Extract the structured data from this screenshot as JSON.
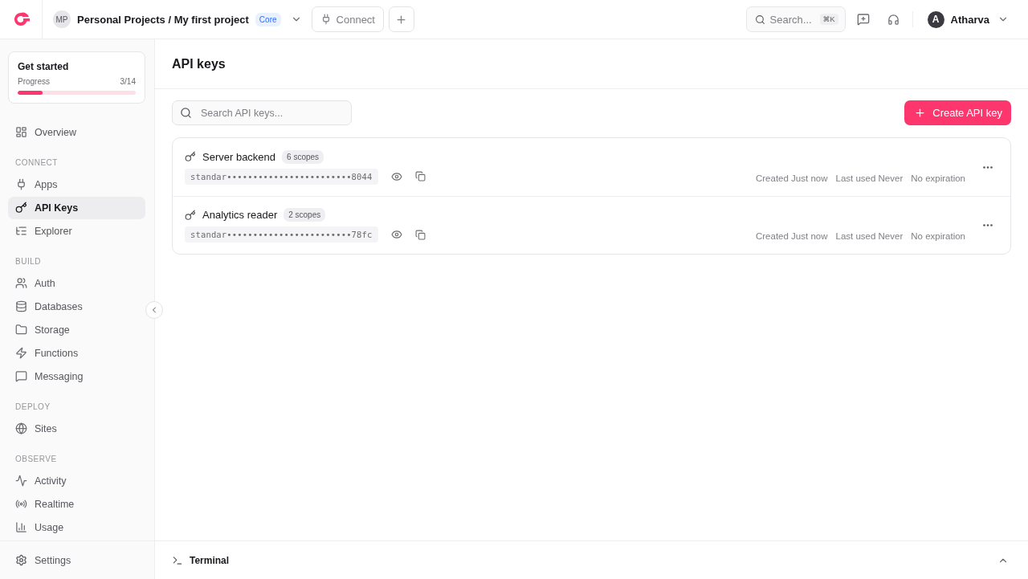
{
  "header": {
    "project_initials": "MP",
    "project_path": "Personal Projects / My first project",
    "plan_badge": "Core",
    "connect_button": "Connect",
    "search": {
      "placeholder": "Search...",
      "shortcut": "⌘K"
    },
    "user": {
      "initial": "A",
      "name": "Atharva"
    }
  },
  "sidebar": {
    "get_started": {
      "title": "Get started",
      "progress_label": "Progress",
      "progress_count": "3/14",
      "level": 0.21
    },
    "overview": {
      "label": "Overview",
      "selected": false
    },
    "sections": [
      {
        "heading": "CONNECT",
        "items": [
          {
            "label": "Apps",
            "selected": false
          },
          {
            "label": "API Keys",
            "selected": true
          },
          {
            "label": "Explorer",
            "selected": false
          }
        ]
      },
      {
        "heading": "BUILD",
        "items": [
          {
            "label": "Auth",
            "selected": false
          },
          {
            "label": "Databases",
            "selected": false
          },
          {
            "label": "Storage",
            "selected": false
          },
          {
            "label": "Functions",
            "selected": false
          },
          {
            "label": "Messaging",
            "selected": false
          }
        ]
      },
      {
        "heading": "DEPLOY",
        "items": [
          {
            "label": "Sites",
            "selected": false
          }
        ]
      },
      {
        "heading": "OBSERVE",
        "items": [
          {
            "label": "Activity",
            "selected": false
          },
          {
            "label": "Realtime",
            "selected": false
          },
          {
            "label": "Usage",
            "selected": false
          }
        ]
      }
    ],
    "settings": "Settings"
  },
  "page": {
    "title": "API keys",
    "search": {
      "placeholder": "Search API keys..."
    },
    "create_button": "Create API key",
    "keys": [
      {
        "name": "Server backend",
        "scopes": "6 scopes",
        "secret": "standar••••••••••••••••••••••••8044",
        "created": "Created Just now",
        "last_used": "Last used Never",
        "expiration": "No expiration"
      },
      {
        "name": "Analytics reader",
        "scopes": "2 scopes",
        "secret": "standar••••••••••••••••••••••••78fc",
        "created": "Created Just now",
        "last_used": "Last used Never",
        "expiration": "No expiration"
      }
    ]
  },
  "terminal": {
    "title": "Terminal"
  }
}
